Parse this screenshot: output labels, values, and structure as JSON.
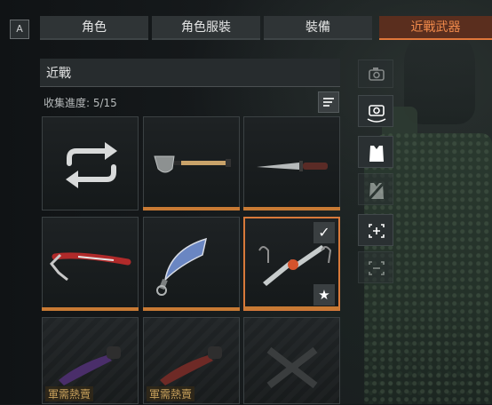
{
  "hotkey": {
    "label": "A"
  },
  "tabs": [
    {
      "label": "角色"
    },
    {
      "label": "角色服裝"
    },
    {
      "label": "裝備"
    },
    {
      "label": "近戰武器",
      "active": true
    }
  ],
  "panel": {
    "title": "近戰",
    "progress": "收集進度: 5/15"
  },
  "grid": {
    "items": [
      {
        "name": "random-melee",
        "owned": false
      },
      {
        "name": "shovel",
        "owned": true
      },
      {
        "name": "combat-knife",
        "owned": true
      },
      {
        "name": "red-ice-pick",
        "owned": true
      },
      {
        "name": "blue-karambit",
        "owned": true
      },
      {
        "name": "twin-blades",
        "owned": true,
        "selected": true,
        "equipped": true,
        "favorite": true
      },
      {
        "name": "purple-knife",
        "owned": false,
        "label": "軍需熱賣"
      },
      {
        "name": "red-knife",
        "owned": false,
        "label": "軍需熱賣"
      },
      {
        "name": "cross-blades",
        "owned": false
      }
    ]
  },
  "badges": {
    "check": "✓",
    "star": "★"
  },
  "colors": {
    "accent": "#e0773a",
    "owned_bar": "#c87a34",
    "locked_label": "#c8a15c",
    "active_tab_bg": "#5a2e1e"
  },
  "toolbar": {
    "icons": [
      "camera-icon",
      "camera-rotate-icon",
      "vest-icon",
      "vest-hide-icon",
      "zoom-in-icon",
      "zoom-out-icon"
    ]
  }
}
